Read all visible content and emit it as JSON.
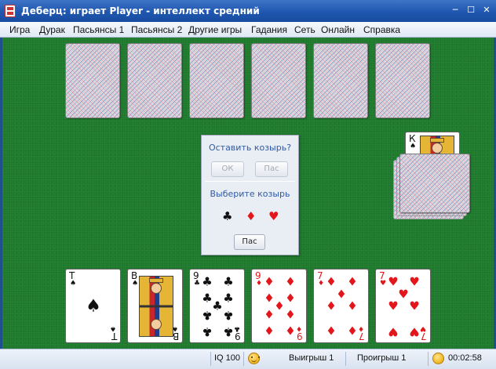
{
  "window": {
    "title": "Деберц: играет Player - интеллект средний",
    "minimize": "─",
    "maximize": "☐",
    "close": "✕"
  },
  "menu": [
    "Игра",
    "Дурак",
    "Пасьянсы 1",
    "Пасьянсы 2",
    "Другие игры",
    "Гадания",
    "Сеть",
    "Онлайн",
    "Справка"
  ],
  "opponent_hand": {
    "count": 6
  },
  "talon": {
    "trump_card": {
      "rank": "К",
      "suit": "♠",
      "color": "black",
      "face": "king"
    }
  },
  "dialog": {
    "question1": "Оставить козырь?",
    "ok_label": "ОК",
    "pass_label": "Пас",
    "question2": "Выберите козырь",
    "suits": [
      {
        "symbol": "♣",
        "name": "clubs",
        "color": "black"
      },
      {
        "symbol": "♦",
        "name": "diamonds",
        "color": "red"
      },
      {
        "symbol": "♥",
        "name": "hearts",
        "color": "red"
      }
    ],
    "pass2_label": "Пас"
  },
  "player_hand": [
    {
      "rank": "Т",
      "suit": "♠",
      "color": "black",
      "pips": 1
    },
    {
      "rank": "В",
      "suit": "♠",
      "color": "black",
      "face": "jack"
    },
    {
      "rank": "9",
      "suit": "♣",
      "color": "black",
      "pips": 9
    },
    {
      "rank": "9",
      "suit": "♦",
      "color": "red",
      "pips": 9
    },
    {
      "rank": "7",
      "suit": "♦",
      "color": "red",
      "pips": 7
    },
    {
      "rank": "7",
      "suit": "♥",
      "color": "red",
      "pips": 7
    }
  ],
  "status": {
    "iq": "IQ 100",
    "wins": "Выигрыш 1",
    "losses": "Проигрыш 1",
    "time": "00:02:58"
  }
}
